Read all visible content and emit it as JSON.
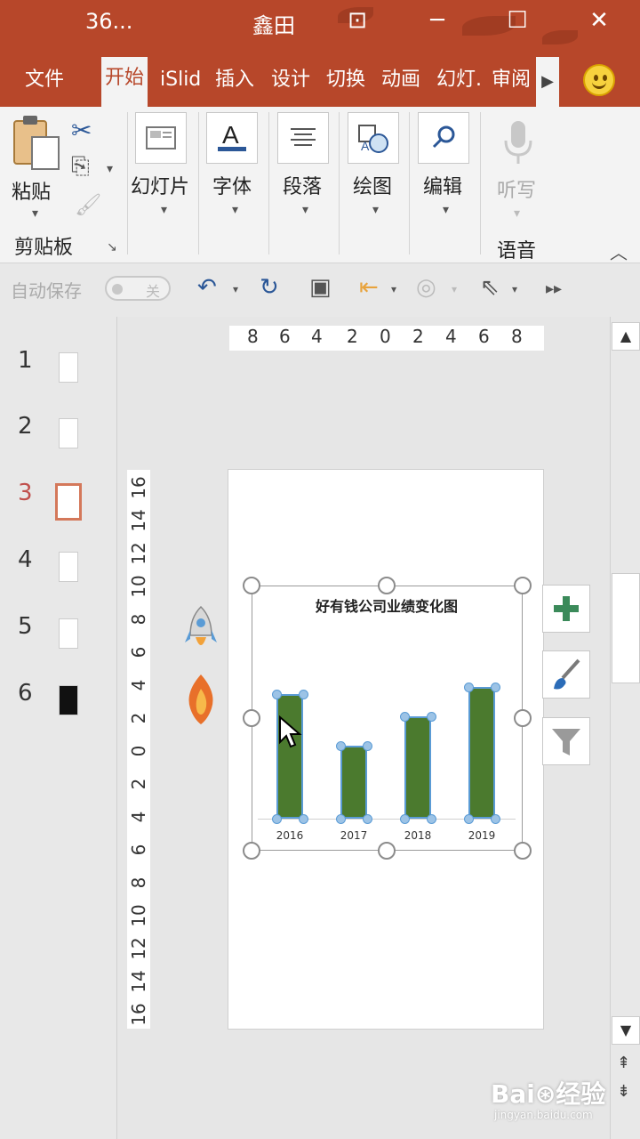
{
  "window": {
    "doc_title": "36...",
    "user_name": "鑫田",
    "restore_glyph": "⊡",
    "minimize_glyph": "─",
    "maximize_glyph": "☐",
    "close_glyph": "✕"
  },
  "tabs": [
    "文件",
    "开始",
    "iSlid",
    "插入",
    "设计",
    "切换",
    "动画",
    "幻灯.",
    "审阅"
  ],
  "active_tab": "开始",
  "ribbon": {
    "paste": "粘贴",
    "clipboard_group": "剪贴板",
    "slides": "幻灯片",
    "font": "字体",
    "paragraph": "段落",
    "drawing": "绘图",
    "editing": "编辑",
    "dictate": "听写",
    "voice_group": "语音"
  },
  "quick_access": {
    "autosave": "自动保存",
    "toggle_state": "关"
  },
  "slides": [
    {
      "number": "1"
    },
    {
      "number": "2"
    },
    {
      "number": "3"
    },
    {
      "number": "4"
    },
    {
      "number": "5"
    },
    {
      "number": "6"
    }
  ],
  "active_slide": "3",
  "rulers": {
    "horizontal": [
      "8",
      "6",
      "4",
      "2",
      "0",
      "2",
      "4",
      "6",
      "8"
    ],
    "vertical": [
      "16",
      "14",
      "12",
      "10",
      "8",
      "6",
      "4",
      "2",
      "0",
      "2",
      "4",
      "6",
      "8",
      "10",
      "12",
      "14",
      "16"
    ]
  },
  "chart_data": {
    "type": "bar",
    "title": "好有钱公司业绩变化图",
    "categories": [
      "2016",
      "2017",
      "2018",
      "2019"
    ],
    "values": [
      140,
      82,
      115,
      148
    ],
    "ylim": [
      0,
      160
    ],
    "grid": false,
    "legend": "none",
    "bar_color": "#4b7a2e"
  },
  "watermark": {
    "brand": "Bai⊛经验",
    "url": "jingyan.baidu.com"
  },
  "colors": {
    "accent": "#b7472a",
    "ribbon_bg": "#f3f3f3",
    "selection": "#5a9bd5"
  }
}
